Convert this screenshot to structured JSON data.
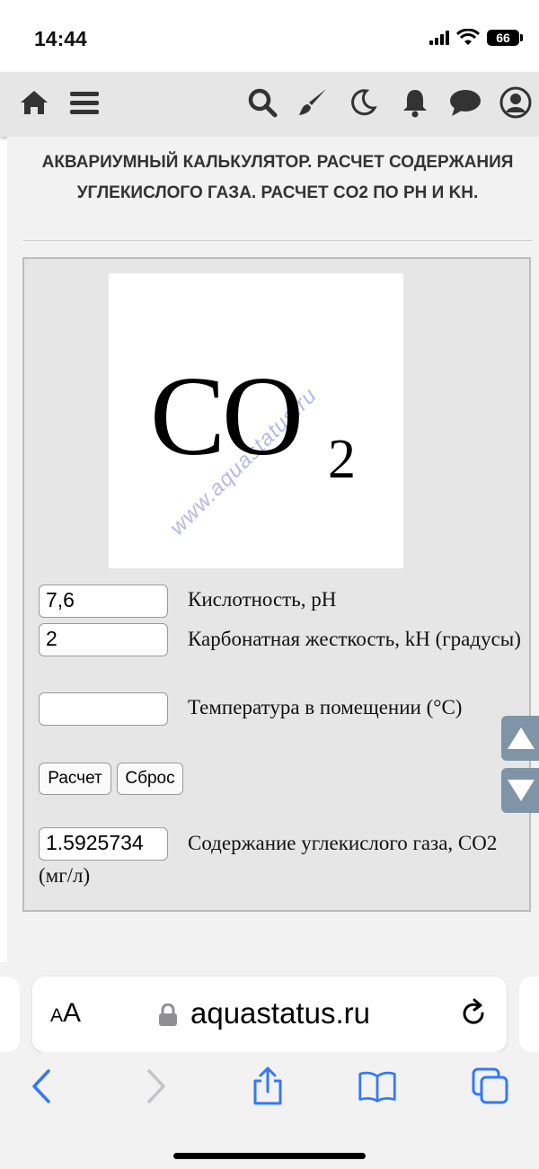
{
  "status_bar": {
    "time": "14:44",
    "battery": "66"
  },
  "site_nav": {
    "icons": [
      "home-icon",
      "menu-icon",
      "search-icon",
      "brush-icon",
      "moon-icon",
      "bell-icon",
      "chat-icon",
      "user-icon"
    ]
  },
  "page": {
    "title": "Аквариумный калькулятор. Расчет содержания углекислого газа. Расчет CO2 по pH и kH."
  },
  "image": {
    "formula": "CO",
    "subscript": "2",
    "watermark": "www.aquastatus.ru"
  },
  "form": {
    "ph_value": "7,6",
    "ph_label": "Кислотность, pH",
    "kh_value": "2",
    "kh_label": "Карбонатная жесткость, kH (градусы)",
    "temp_value": "",
    "temp_label": "Температура в помещении (°C)",
    "calc_button": "Расчет",
    "reset_button": "Сброс",
    "result_value": "1.5925734",
    "result_label": "Содержание углекислого газа, CO2 (мг/л)"
  },
  "browser": {
    "aa_small": "A",
    "aa_large": "A",
    "url": "aquastatus.ru"
  },
  "colors": {
    "accent_link": "#3478f6",
    "scroll_button": "#7f94a6",
    "nav_bar": "#e6e6e6"
  }
}
